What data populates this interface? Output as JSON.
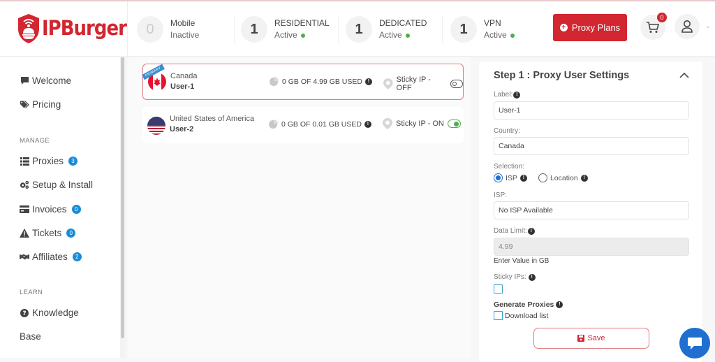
{
  "header": {
    "logo_text": "IPBurger",
    "stats": [
      {
        "count": "0",
        "title": "Mobile",
        "status": "Inactive",
        "active": false
      },
      {
        "count": "1",
        "title": "RESIDENTIAL",
        "status": "Active",
        "active": true
      },
      {
        "count": "1",
        "title": "DEDICATED",
        "status": "Active",
        "active": true
      },
      {
        "count": "1",
        "title": "VPN",
        "status": "Active",
        "active": true
      }
    ],
    "proxy_plans_label": "Proxy Plans",
    "cart_count": "0"
  },
  "sidebar": {
    "items": [
      {
        "label": "Welcome",
        "icon": "comment-icon"
      },
      {
        "label": "Pricing",
        "icon": "tags-icon"
      }
    ],
    "manage_label": "MANAGE",
    "manage_items": [
      {
        "label": "Proxies",
        "icon": "list-icon",
        "badge": "3"
      },
      {
        "label": "Setup & Install",
        "icon": "gears-icon",
        "badge": null
      },
      {
        "label": "Invoices",
        "icon": "credit-card-icon",
        "badge": "0"
      },
      {
        "label": "Tickets",
        "icon": "warning-icon",
        "badge": "0"
      },
      {
        "label": "Affiliates",
        "icon": "handshake-icon",
        "badge": "2"
      }
    ],
    "learn_label": "LEARN",
    "learn_items": [
      {
        "label": "Knowledge",
        "icon": "question-circle-icon"
      },
      {
        "label": "Base",
        "icon": null
      }
    ]
  },
  "proxies": [
    {
      "country": "Canada",
      "user": "User-1",
      "primary": true,
      "primary_label": "PRIMARY",
      "usage": "0 GB OF 4.99 GB USED",
      "sticky": "Sticky IP - OFF",
      "sticky_on": false
    },
    {
      "country": "United States of America",
      "user": "User-2",
      "primary": false,
      "usage": "0 GB OF 0.01 GB USED",
      "sticky": "Sticky IP - ON",
      "sticky_on": true
    }
  ],
  "settings": {
    "title": "Step 1 : Proxy User Settings",
    "label_label": "Label:",
    "label_value": "User-1",
    "country_label": "Country:",
    "country_value": "Canada",
    "selection_label": "Selection:",
    "selection_options": [
      "ISP",
      "Location"
    ],
    "selection_selected": "ISP",
    "isp_label": "ISP:",
    "isp_value": "No ISP Available",
    "data_limit_label": "Data Limit:",
    "data_limit_value": "4.99",
    "data_limit_hint": "Enter Value in GB",
    "sticky_label": "Sticky IPs:",
    "sticky_checked": false,
    "generate_label": "Generate Proxies",
    "download_label": "Download list",
    "download_checked": false,
    "save_label": "Save"
  },
  "colors": {
    "brand_red": "#d22630",
    "badge_blue": "#1a8cd8",
    "active_green": "#4caf50",
    "chat_blue": "#1f6fd1"
  }
}
